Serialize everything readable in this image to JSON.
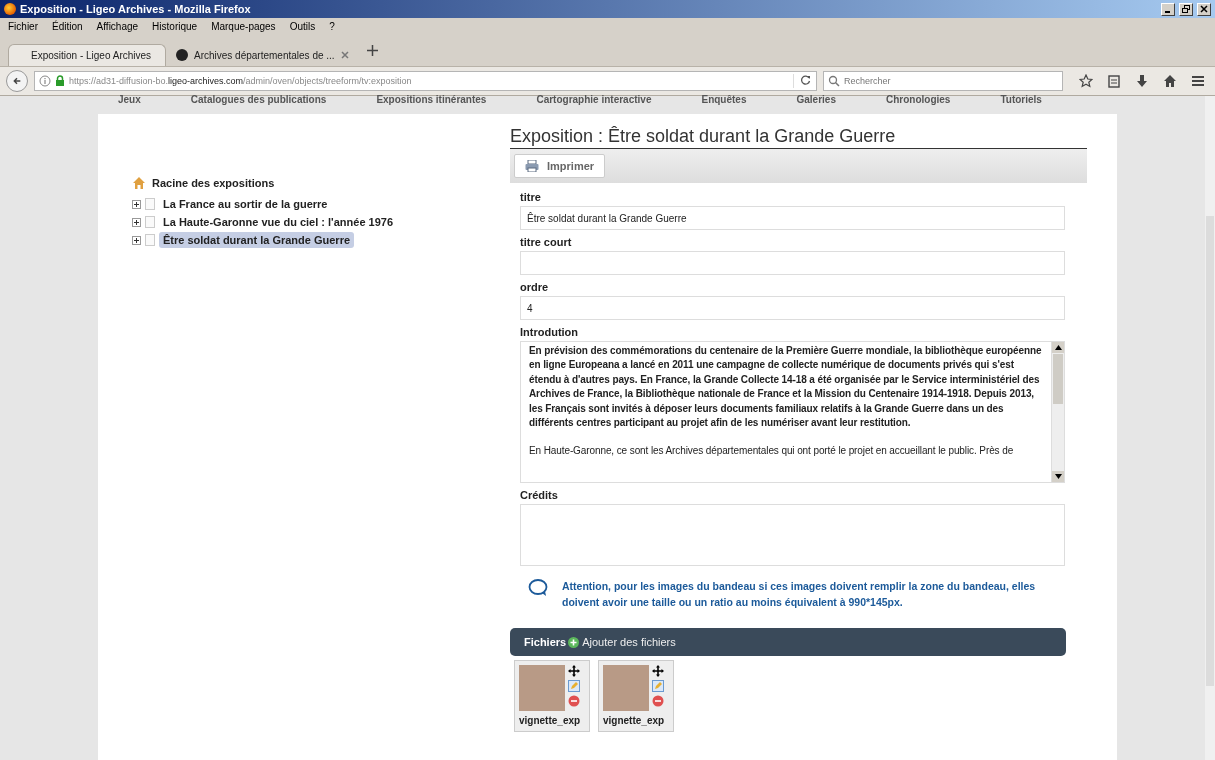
{
  "window": {
    "title": "Exposition - Ligeo Archives - Mozilla Firefox"
  },
  "menu": [
    "Fichier",
    "Édition",
    "Affichage",
    "Historique",
    "Marque-pages",
    "Outils",
    "?"
  ],
  "tabs": [
    {
      "label": "Exposition - Ligeo Archives",
      "selected": true
    },
    {
      "label": "Archives départementales de ...",
      "selected": false
    }
  ],
  "address": {
    "prefix": "https://ad31-diffusion-bo.",
    "domain": "ligeo-archives.com",
    "path": "/admin/oven/objects/treeform/tv:exposition"
  },
  "search": {
    "placeholder": "Rechercher"
  },
  "site_nav": [
    "Jeux",
    "Catalogues des publications",
    "Expositions itinérantes",
    "Cartographie interactive",
    "Enquêtes",
    "Galeries",
    "Chronologies",
    "Tutoriels"
  ],
  "tree": {
    "root": "Racine des expositions",
    "children": [
      {
        "label": "La France au sortir de la guerre",
        "selected": false
      },
      {
        "label": "La Haute-Garonne vue du ciel : l'année 1976",
        "selected": false
      },
      {
        "label": "Être soldat durant la Grande Guerre",
        "selected": true
      }
    ]
  },
  "form": {
    "heading": "Exposition : Être soldat durant la Grande Guerre",
    "print_button": "Imprimer",
    "fields": [
      {
        "label": "titre",
        "value": "Être soldat durant la Grande Guerre"
      },
      {
        "label": "titre court"
      },
      {
        "label": "ordre",
        "value": "4"
      }
    ],
    "introduction": {
      "label": "Introdution",
      "paragraphs": [
        {
          "text": "En prévision des commémorations du centenaire de la Première Guerre mondiale, la bibliothèque européenne en ligne Europeana a lancé en 2011 une campagne de collecte numérique de documents privés qui s'est étendu à d'autres pays. En France, la Grande Collecte 14-18 a été organisée par le Service interministériel des Archives de France, la Bibliothèque nationale de France et la Mission du Centenaire 1914-1918. Depuis 2013, les Français sont invités à déposer leurs documents familiaux relatifs à la Grande Guerre dans un des différents centres participant au projet afin de les numériser avant leur restitution.",
          "bold": true
        },
        {
          "text": "En Haute-Garonne, ce sont les Archives départementales qui ont porté le projet en accueillant le public. Près de",
          "bold": false
        }
      ]
    },
    "credits": {
      "label": "Crédits"
    },
    "notice": "Attention, pour les images du bandeau si ces images doivent remplir la zone du bandeau, elles doivent avoir une taille ou un ratio au moins équivalent à 990*145px.",
    "files": {
      "title": "Fichiers",
      "add": "Ajouter des fichiers",
      "items": [
        {
          "name": "vignette_exp"
        },
        {
          "name": "vignette_exp"
        }
      ]
    }
  }
}
